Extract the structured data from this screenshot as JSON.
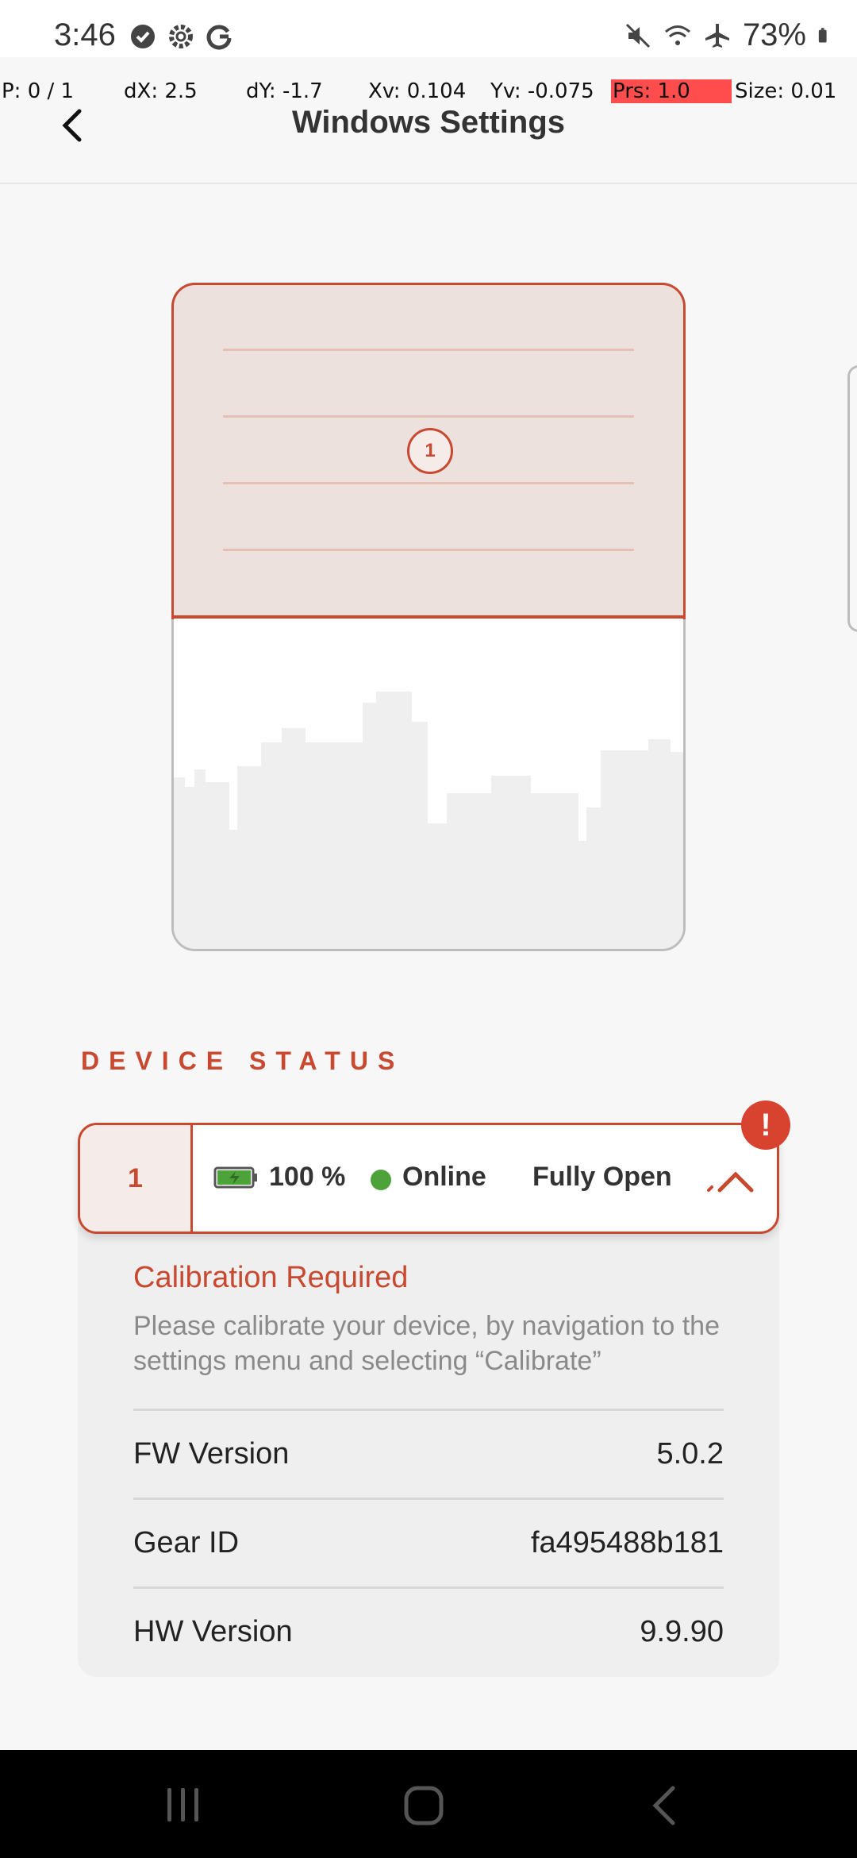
{
  "status_bar": {
    "time": "3:46",
    "battery_percent": "73%",
    "left_icons": [
      "shield-check-icon",
      "settings-icon",
      "google-icon"
    ],
    "right_icons": [
      "mute-icon",
      "wifi-icon",
      "airplane-icon",
      "battery-icon"
    ]
  },
  "pointer_overlay": {
    "p": "P: 0 / 1",
    "dx": "dX: 2.5",
    "dy": "dY: -1.7",
    "xv": "Xv: 0.104",
    "yv": "Yv: -0.075",
    "prs": "Prs: 1.0",
    "size": "Size: 0.01"
  },
  "header": {
    "title": "Windows Settings",
    "back_icon": "chevron-left-icon"
  },
  "window_preview": {
    "shade_number": "1",
    "shade_level": "Fully Open"
  },
  "device_status": {
    "section_title": "DEVICE STATUS",
    "device": {
      "number": "1",
      "battery": "100 %",
      "connection": "Online",
      "position": "Fully Open",
      "alert": "!"
    },
    "calibration": {
      "title": "Calibration Required",
      "message": "Please calibrate your device, by navigation to the settings menu and selecting “Calibrate”"
    },
    "info": [
      {
        "label": "FW Version",
        "value": "5.0.2"
      },
      {
        "label": "Gear ID",
        "value": "fa495488b181"
      },
      {
        "label": "HW Version",
        "value": "9.9.90"
      }
    ]
  },
  "colors": {
    "accent": "#c8492f",
    "shade_fill": "#ede1dd",
    "online": "#4ea23a",
    "alert": "#d7432f"
  },
  "nav_bar": {
    "buttons": [
      "recents-icon",
      "home-icon",
      "back-icon"
    ]
  }
}
